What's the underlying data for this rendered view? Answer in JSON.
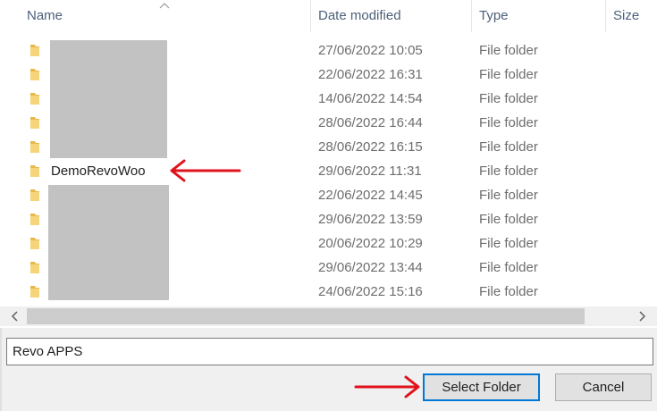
{
  "columns": {
    "name": "Name",
    "date_modified": "Date modified",
    "type": "Type",
    "size": "Size"
  },
  "rows": [
    {
      "name": "",
      "date": "27/06/2022 10:05",
      "type": "File folder"
    },
    {
      "name": "",
      "date": "22/06/2022 16:31",
      "type": "File folder"
    },
    {
      "name": "",
      "date": "14/06/2022 14:54",
      "type": "File folder"
    },
    {
      "name": "",
      "date": "28/06/2022 16:44",
      "type": "File folder"
    },
    {
      "name": "",
      "date": "28/06/2022 16:15",
      "type": "File folder"
    },
    {
      "name": "DemoRevoWoo",
      "date": "29/06/2022 11:31",
      "type": "File folder"
    },
    {
      "name": "",
      "date": "22/06/2022 14:45",
      "type": "File folder"
    },
    {
      "name": "",
      "date": "29/06/2022 13:59",
      "type": "File folder"
    },
    {
      "name": "",
      "date": "20/06/2022 10:29",
      "type": "File folder"
    },
    {
      "name": "",
      "date": "29/06/2022 13:44",
      "type": "File folder"
    },
    {
      "name": "",
      "date": "24/06/2022 15:16",
      "type": "File folder"
    }
  ],
  "folder_input": {
    "value": "Revo APPS"
  },
  "buttons": {
    "select_folder": "Select Folder",
    "cancel": "Cancel"
  },
  "colors": {
    "annotation_arrow": "#e0121b",
    "primary_border": "#0078d7",
    "folder_icon": "#e8b84a",
    "redaction": "#c2c2c2"
  },
  "icons": {
    "folder": "folder-icon",
    "sort": "sort-ascending-icon",
    "scroll_left": "chevron-left-icon",
    "scroll_right": "chevron-right-icon",
    "annotation": "red-arrow-icon"
  }
}
